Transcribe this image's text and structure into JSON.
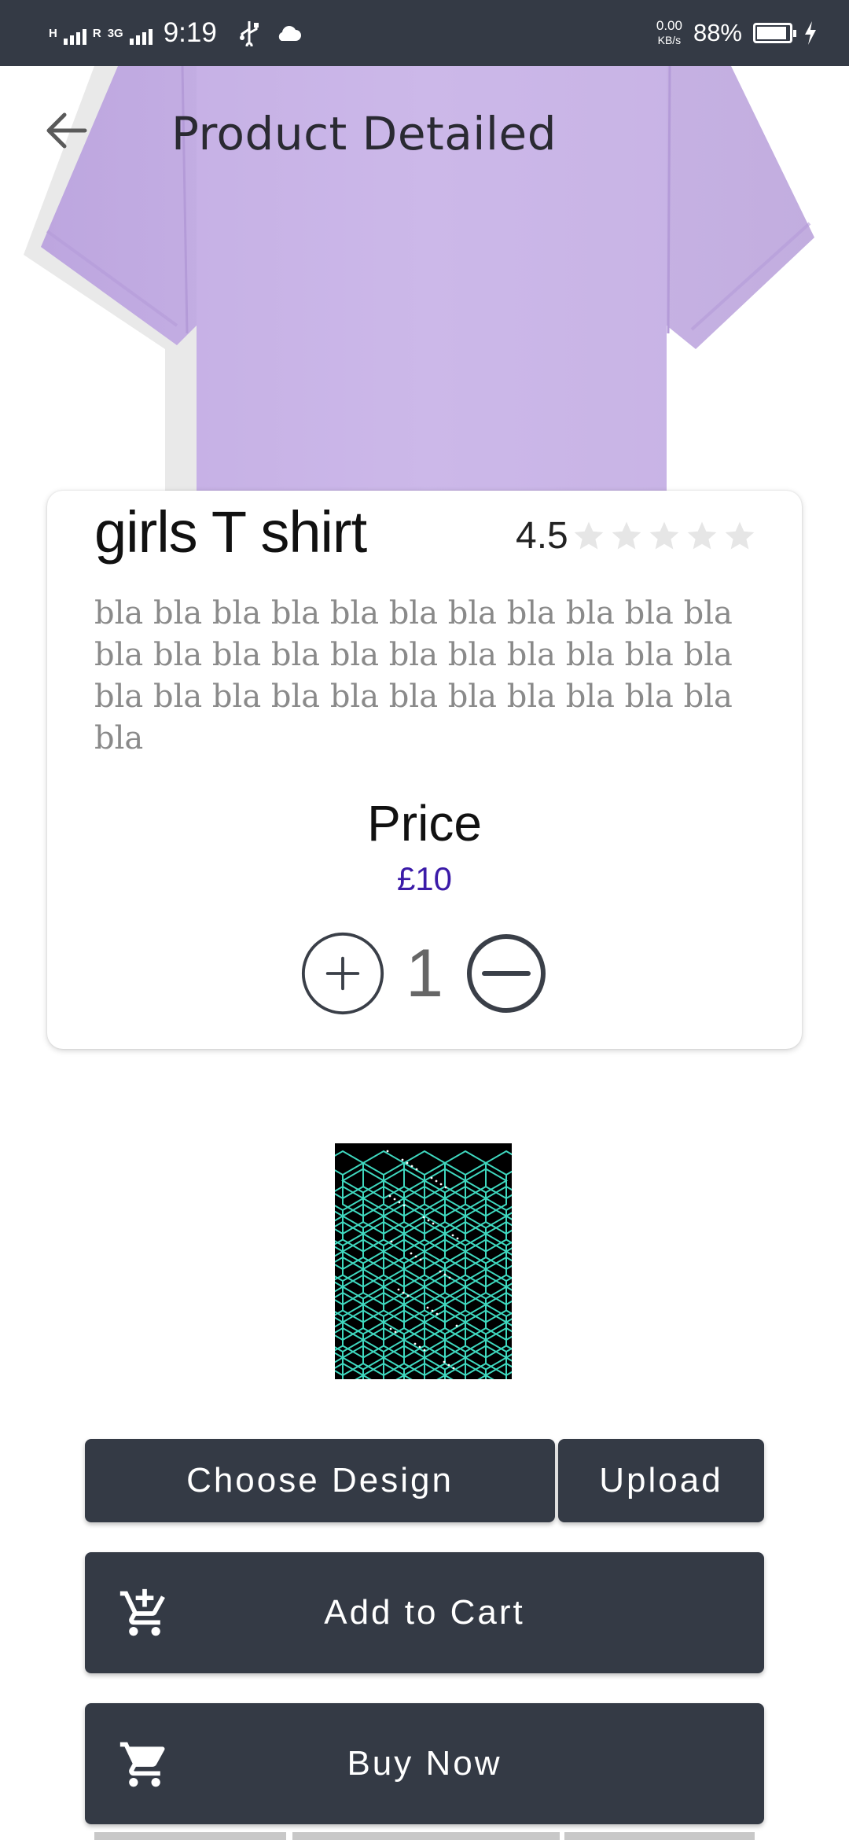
{
  "status_bar": {
    "network_1": "H",
    "network_roaming": "R",
    "network_2": "3G",
    "time": "9:19",
    "speed_value": "0.00",
    "speed_unit": "KB/s",
    "battery": "88%"
  },
  "header": {
    "title": "Product Detailed",
    "back_icon": "arrow-left-icon"
  },
  "hero": {
    "image": "lavender-tshirt",
    "color": "#c9b5e6"
  },
  "product": {
    "name": "girls T shirt",
    "rating": "4.5",
    "stars_total": 5,
    "stars_filled": 0,
    "description": "bla bla bla bla bla bla bla bla bla bla bla bla bla bla bla bla bla bla bla bla bla bla bla bla bla bla bla bla bla bla bla bla bla bla",
    "price_label": "Price",
    "price_value": "£10",
    "quantity": "1",
    "increase_icon": "plus-circle-icon",
    "decrease_icon": "minus-circle-icon"
  },
  "design": {
    "thumbnail": "isometric-cube-pattern"
  },
  "actions": {
    "choose_design": "Choose Design",
    "upload": "Upload",
    "add_to_cart": "Add to Cart",
    "add_to_cart_icon": "cart-plus-icon",
    "buy_now": "Buy Now",
    "buy_now_icon": "cart-icon"
  },
  "colors": {
    "primary_dark": "#343a45",
    "price_accent": "#3b1ba8",
    "star_empty": "#e6e6e6"
  }
}
